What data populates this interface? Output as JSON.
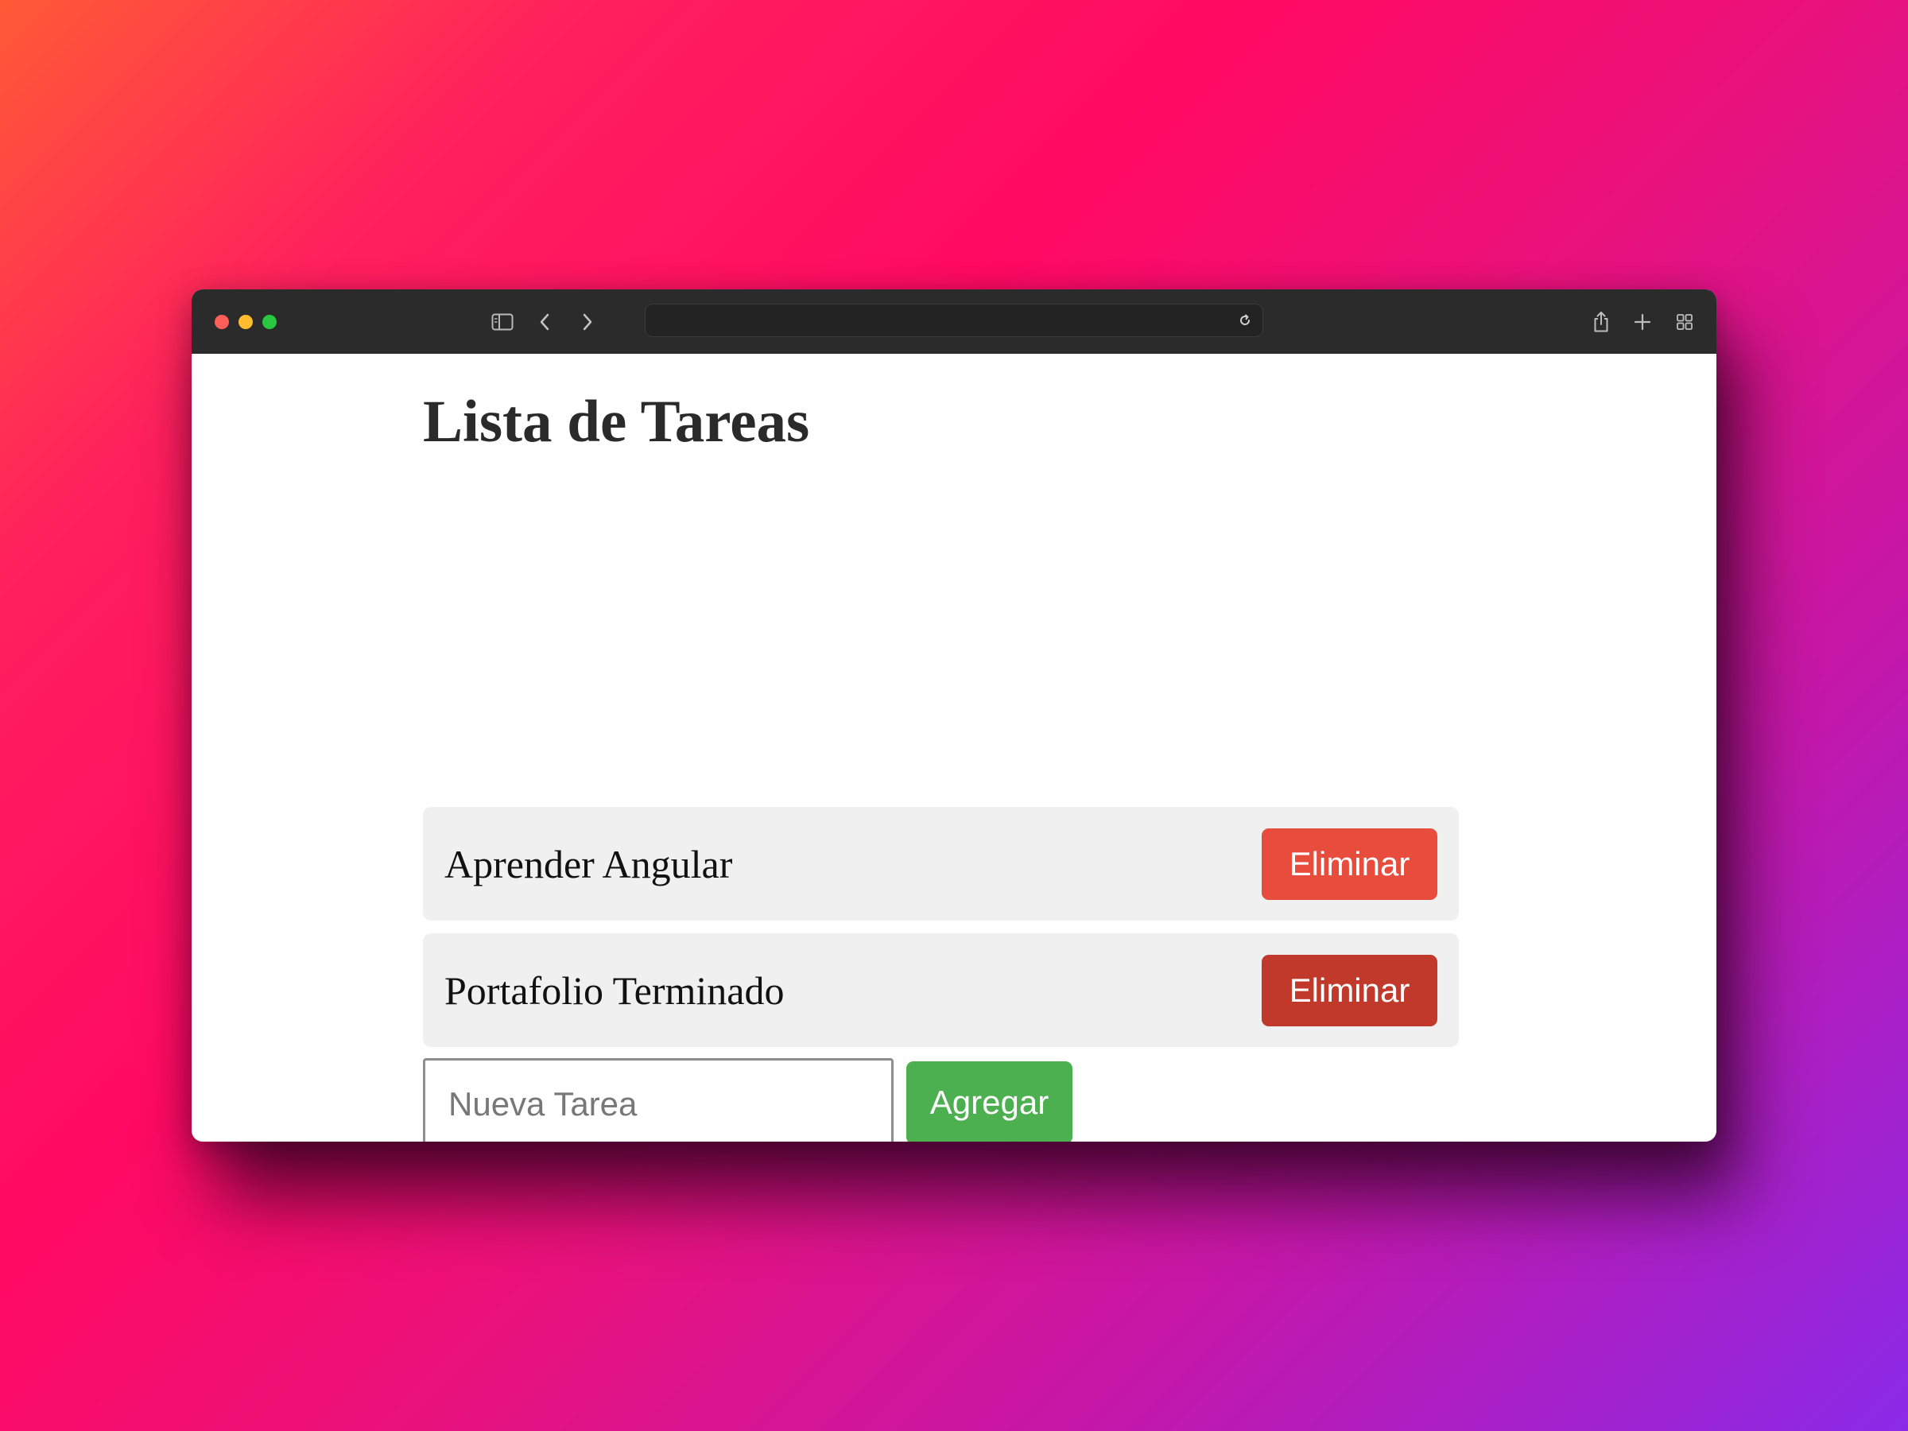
{
  "browser": {
    "address": "",
    "icons": {
      "sidebar": "sidebar-icon",
      "back": "chevron-left-icon",
      "forward": "chevron-right-icon",
      "reload": "reload-icon",
      "share": "share-icon",
      "new_tab": "plus-icon",
      "tabs": "tab-overview-icon"
    }
  },
  "page": {
    "title": "Lista de Tareas",
    "tasks": [
      {
        "text": "Aprender Angular",
        "delete_label": "Eliminar",
        "delete_color": "#e74c3c"
      },
      {
        "text": "Portafolio Terminado",
        "delete_label": "Eliminar",
        "delete_color": "#c0392b"
      }
    ],
    "new_task": {
      "placeholder": "Nueva Tarea",
      "value": "",
      "add_label": "Agregar",
      "add_color": "#4caf50"
    }
  }
}
